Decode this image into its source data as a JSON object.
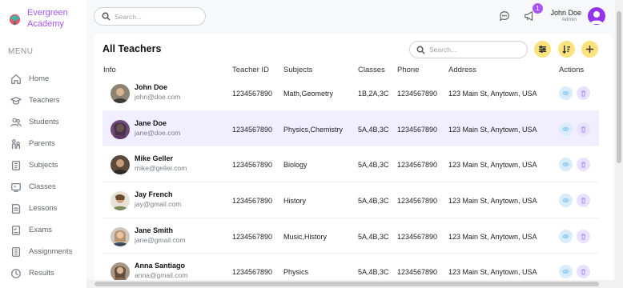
{
  "brand": {
    "name": "Evergreen Academy"
  },
  "menu": {
    "title": "MENU",
    "items": [
      {
        "label": "Home",
        "icon": "home-icon"
      },
      {
        "label": "Teachers",
        "icon": "graduation-cap-icon"
      },
      {
        "label": "Students",
        "icon": "students-icon"
      },
      {
        "label": "Parents",
        "icon": "parents-icon"
      },
      {
        "label": "Subjects",
        "icon": "book-icon"
      },
      {
        "label": "Classes",
        "icon": "class-icon"
      },
      {
        "label": "Lessons",
        "icon": "lesson-icon"
      },
      {
        "label": "Exams",
        "icon": "exam-icon"
      },
      {
        "label": "Assignments",
        "icon": "assignment-icon"
      },
      {
        "label": "Results",
        "icon": "results-icon"
      }
    ]
  },
  "topbar": {
    "search_placeholder": "Search...",
    "notification_count": "1",
    "user_name": "John Doe",
    "user_role": "Admin"
  },
  "main": {
    "title": "All Teachers",
    "search_placeholder": "Search...",
    "columns": [
      "Info",
      "Teacher ID",
      "Subjects",
      "Classes",
      "Phone",
      "Address",
      "Actions"
    ],
    "rows": [
      {
        "name": "John Doe",
        "email": "john@doe.com",
        "teacher_id": "1234567890",
        "subjects": "Math,Geometry",
        "classes": "1B,2A,3C",
        "phone": "1234567890",
        "address": "123 Main St, Anytown, USA"
      },
      {
        "name": "Jane Doe",
        "email": "jane@doe.com",
        "teacher_id": "1234567890",
        "subjects": "Physics,Chemistry",
        "classes": "5A,4B,3C",
        "phone": "1234567890",
        "address": "123 Main St, Anytown, USA"
      },
      {
        "name": "Mike Geller",
        "email": "mike@geller.com",
        "teacher_id": "1234567890",
        "subjects": "Biology",
        "classes": "5A,4B,3C",
        "phone": "1234567890",
        "address": "123 Main St, Anytown, USA"
      },
      {
        "name": "Jay French",
        "email": "jay@gmail.com",
        "teacher_id": "1234567890",
        "subjects": "History",
        "classes": "5A,4B,3C",
        "phone": "1234567890",
        "address": "123 Main St, Anytown, USA"
      },
      {
        "name": "Jane Smith",
        "email": "jane@gmail.com",
        "teacher_id": "1234567890",
        "subjects": "Music,History",
        "classes": "5A,4B,3C",
        "phone": "1234567890",
        "address": "123 Main St, Anytown, USA"
      },
      {
        "name": "Anna Santiago",
        "email": "anna@gmail.com",
        "teacher_id": "1234567890",
        "subjects": "Physics",
        "classes": "5A,4B,3C",
        "phone": "1234567890",
        "address": "123 Main St, Anytown, USA"
      }
    ]
  },
  "colors": {
    "accent": "#A855F7",
    "highlight_row": "#F1EEFF",
    "action_yellow": "#FAE27C",
    "view_button": "#D9ECFA",
    "delete_button": "#E9E2FF"
  }
}
